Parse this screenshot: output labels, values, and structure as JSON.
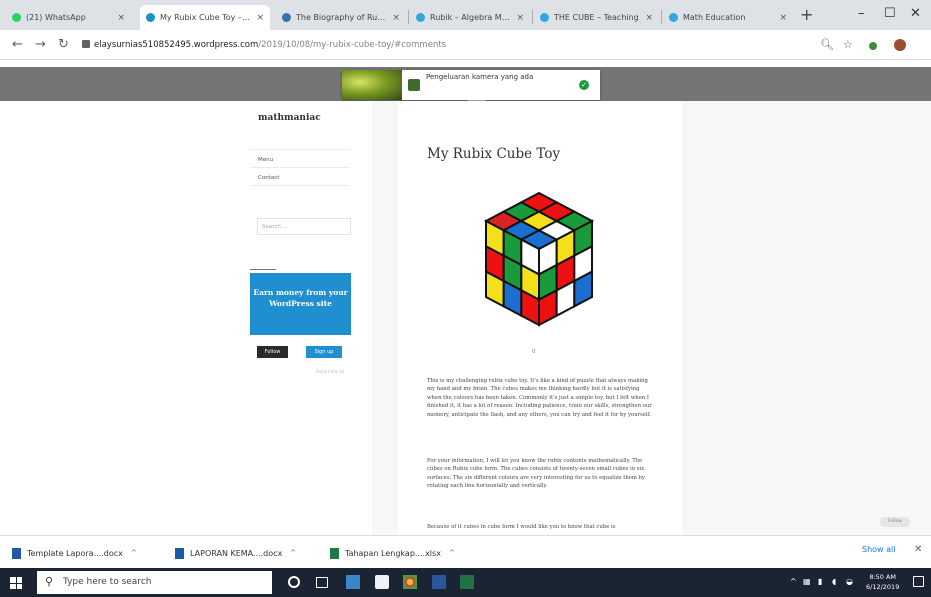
{
  "browser": {
    "tabs": [
      {
        "label": "(21) WhatsApp",
        "favicon_color": "#25d366"
      },
      {
        "label": "My Rubix Cube Toy – mathmaniac",
        "favicon_color": "#1f8fd0",
        "active": true
      },
      {
        "label": "The Biography of Rubik",
        "favicon_color": "#3a6fb0"
      },
      {
        "label": "Rubik – Algebra Math",
        "favicon_color": "#2fa8e0"
      },
      {
        "label": "THE CUBE – Teaching",
        "favicon_color": "#2fa8e0"
      },
      {
        "label": "Math Education",
        "favicon_color": "#2fa8e0"
      }
    ],
    "new_tab": "+",
    "window_controls": {
      "minimize": "–",
      "maximize": "☐",
      "close": "✕"
    },
    "url_host": "elaysurnias510852495.wordpress.com",
    "url_path": "/2019/10/08/my-rubix-cube-toy/#comments"
  },
  "popup": {
    "text": "Pengeluaran kamera yang ada"
  },
  "sidebar": {
    "site_title": "mathmaniac",
    "links": [
      "Menu",
      "Contact"
    ],
    "search_placeholder": "Search ...",
    "promo_text": "Earn money from your WordPress site",
    "follow_label": "Follow",
    "signup_label": "Sign up",
    "small_note": "Report this ad"
  },
  "post": {
    "title": "My Rubix Cube Toy",
    "image_caption": "0",
    "paragraph_1": "This is my challenging rubix cube toy. It's like a kind of puzzle that always making my hand and my brain. The cubes makes me thinking hardly but it is satisfying when the colours has been taken. Commonly it's just a simple toy, but I felt when I finished it, it has a lot of reason. Including patience, train our skills, strengthen our memory, anticipate the flash, and any others, you can try and feel it for by yourself.",
    "paragraph_2": "For your information, I will let you know the rubix contents mathematically. The cubes on Rubix cube form. The cubes consists of twenty-seven small cubes in six surfaces. The six different colours are very interesting for us to equalize them by rotating each line horizontally and vertically.",
    "paragraph_3": "Because of it cubes in cube form I would like you to know that cube is"
  },
  "right_badge": "Follow",
  "downloads": {
    "items": [
      {
        "label": "Template Lapora....docx"
      },
      {
        "label": "LAPORAN KEMA....docx"
      },
      {
        "label": "Tahapan Lengkap....xlsx"
      }
    ],
    "show_all": "Show all",
    "close": "✕"
  },
  "taskbar": {
    "search_placeholder": "Type here to search",
    "time": "8:50 AM",
    "date": "6/12/2019"
  }
}
